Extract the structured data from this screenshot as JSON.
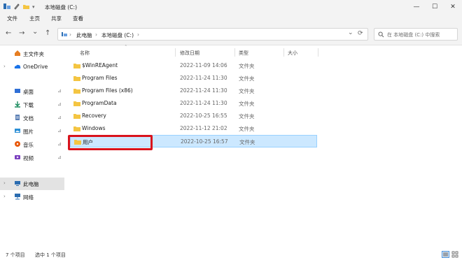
{
  "window": {
    "title": "本地磁盘 (C:)",
    "controls": {
      "minimize": "—",
      "maximize": "☐",
      "close": "✕"
    }
  },
  "menu": {
    "items": [
      "文件",
      "主页",
      "共享",
      "查看"
    ]
  },
  "address": {
    "back": "←",
    "forward": "→",
    "dropdown": "⌄",
    "up": "↑",
    "crumb_sep": "›",
    "crumbs": [
      "此电脑",
      "本地磁盘 (C:)"
    ],
    "refresh": "⟳"
  },
  "search": {
    "placeholder": "在 本地磁盘 (C:) 中搜索"
  },
  "sidebar": {
    "items": [
      {
        "label": "主文件夹",
        "icon": "home-icon",
        "color": "#e67e22"
      },
      {
        "label": "OneDrive",
        "icon": "cloud-icon",
        "color": "#1a73e8"
      },
      {
        "label": "桌面",
        "icon": "desktop-icon",
        "color": "#2f6fd6"
      },
      {
        "label": "下载",
        "icon": "download-icon",
        "color": "#178a5c"
      },
      {
        "label": "文档",
        "icon": "document-icon",
        "color": "#5b7fb5"
      },
      {
        "label": "图片",
        "icon": "pictures-icon",
        "color": "#2b8fd6"
      },
      {
        "label": "音乐",
        "icon": "music-icon",
        "color": "#e8590c"
      },
      {
        "label": "视频",
        "icon": "video-icon",
        "color": "#7b3fbf"
      },
      {
        "label": "此电脑",
        "icon": "this-pc-icon",
        "color": "#2b6cb0"
      },
      {
        "label": "网络",
        "icon": "network-icon",
        "color": "#2b6cb0"
      }
    ]
  },
  "columns": {
    "name": "名称",
    "modified": "修改日期",
    "type": "类型",
    "size": "大小"
  },
  "files": [
    {
      "name": "$WinREAgent",
      "modified": "2022-11-09 14:06",
      "type": "文件夹"
    },
    {
      "name": "Program Files",
      "modified": "2022-11-24 11:30",
      "type": "文件夹"
    },
    {
      "name": "Program Files (x86)",
      "modified": "2022-11-24 11:30",
      "type": "文件夹"
    },
    {
      "name": "ProgramData",
      "modified": "2022-11-24 11:30",
      "type": "文件夹"
    },
    {
      "name": "Recovery",
      "modified": "2022-10-25 16:55",
      "type": "文件夹"
    },
    {
      "name": "Windows",
      "modified": "2022-11-12 21:02",
      "type": "文件夹"
    },
    {
      "name": "用户",
      "modified": "2022-10-25 16:57",
      "type": "文件夹",
      "selected": true
    }
  ],
  "status": {
    "count": "7 个项目",
    "selected": "选中 1 个项目"
  },
  "colors": {
    "selection": "#cce8ff",
    "selection_border": "#99d1ff",
    "highlight": "#d9131c",
    "folder": "#f4c542"
  }
}
